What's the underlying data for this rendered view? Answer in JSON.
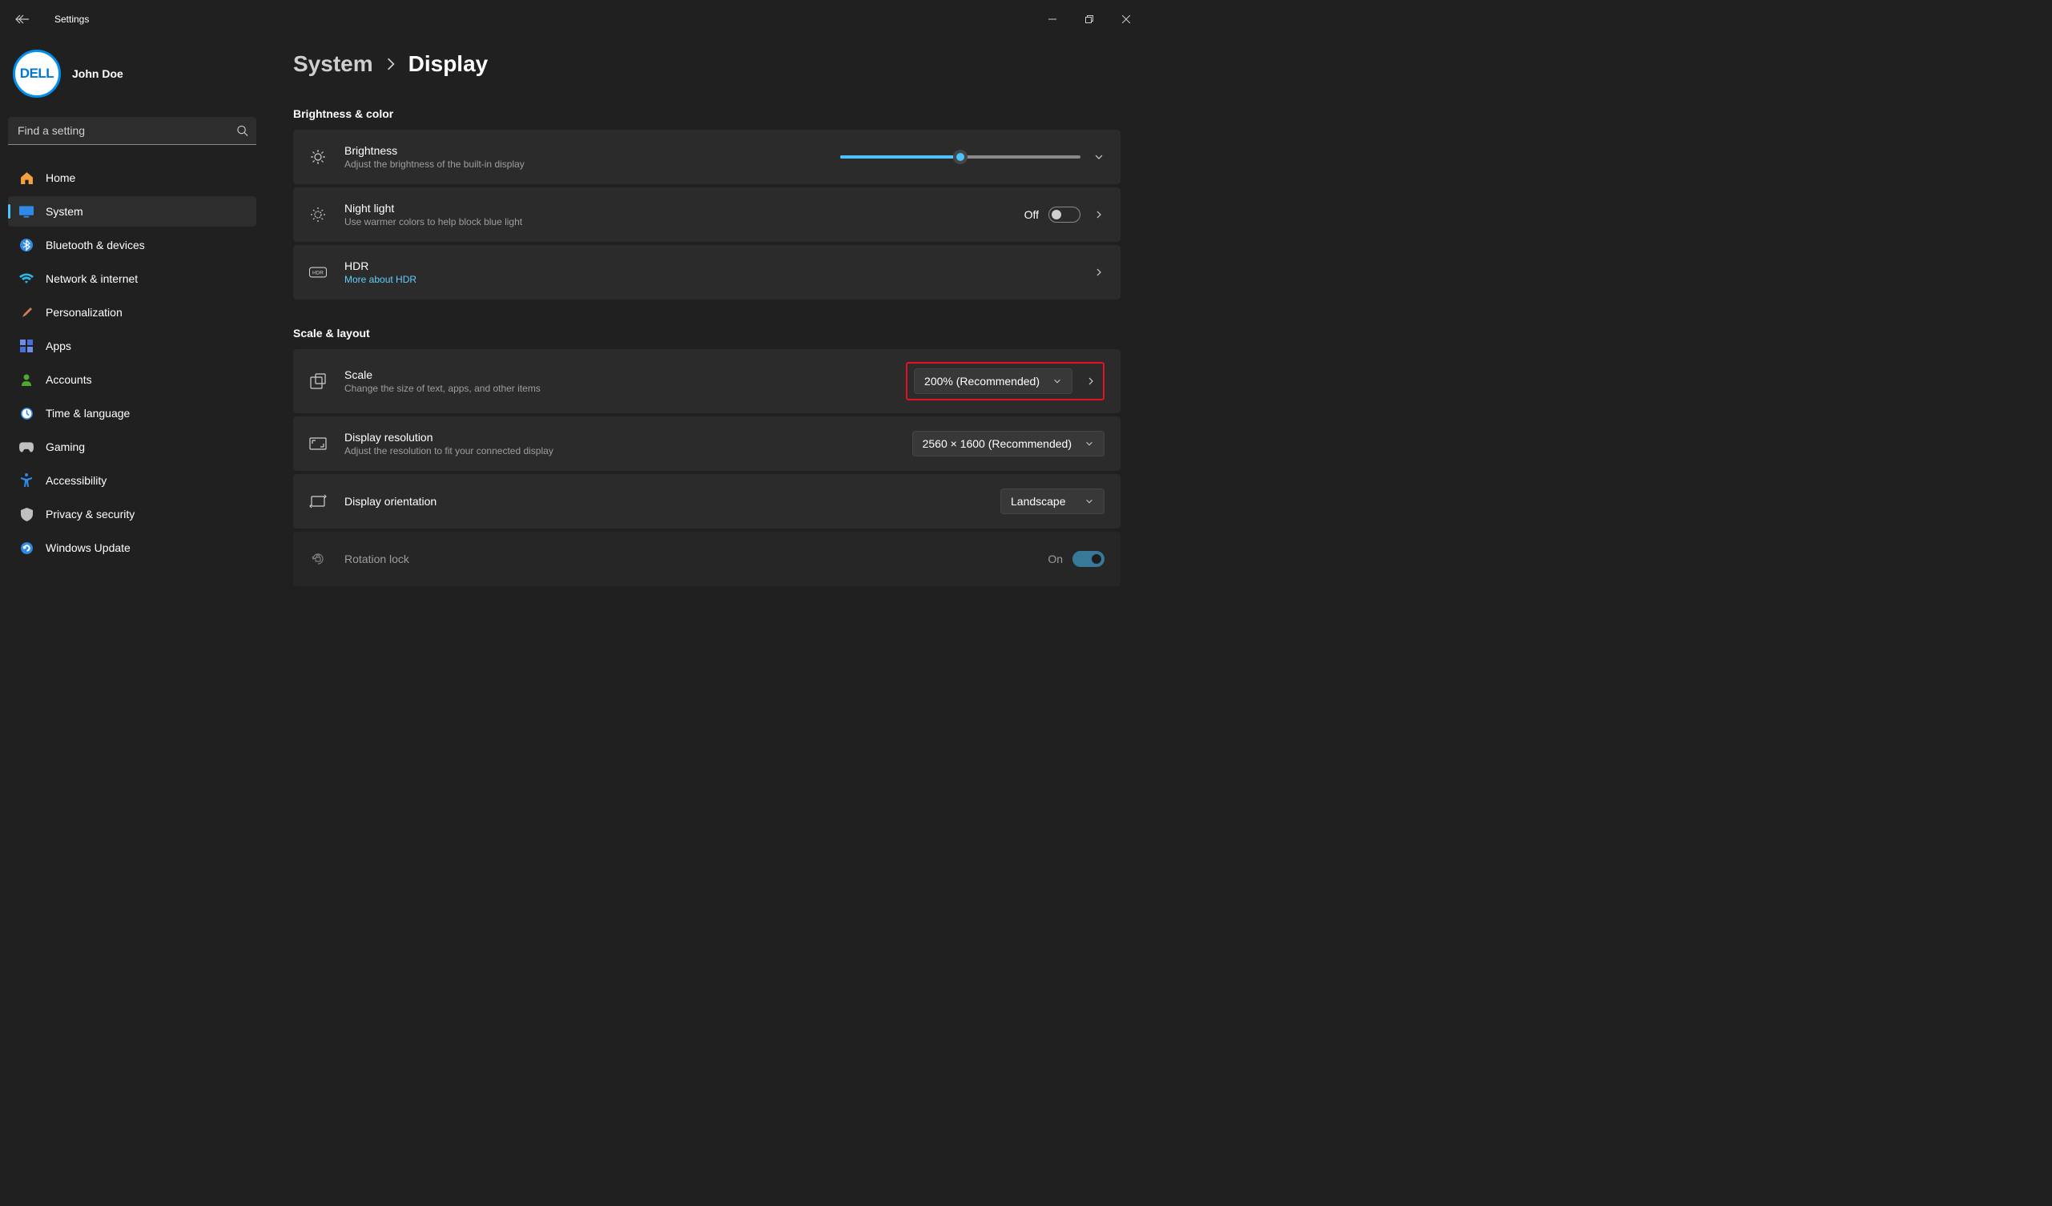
{
  "app": {
    "title": "Settings"
  },
  "user": {
    "name": "John Doe",
    "avatar_text": "DELL"
  },
  "search": {
    "placeholder": "Find a setting"
  },
  "nav": [
    {
      "label": "Home"
    },
    {
      "label": "System"
    },
    {
      "label": "Bluetooth & devices"
    },
    {
      "label": "Network & internet"
    },
    {
      "label": "Personalization"
    },
    {
      "label": "Apps"
    },
    {
      "label": "Accounts"
    },
    {
      "label": "Time & language"
    },
    {
      "label": "Gaming"
    },
    {
      "label": "Accessibility"
    },
    {
      "label": "Privacy & security"
    },
    {
      "label": "Windows Update"
    }
  ],
  "breadcrumb": {
    "parent": "System",
    "current": "Display"
  },
  "sections": {
    "brightness_color": {
      "title": "Brightness & color",
      "brightness": {
        "title": "Brightness",
        "sub": "Adjust the brightness of the built-in display",
        "percent": 50
      },
      "night_light": {
        "title": "Night light",
        "sub": "Use warmer colors to help block blue light",
        "state_label": "Off",
        "on": false
      },
      "hdr": {
        "title": "HDR",
        "link": "More about HDR"
      }
    },
    "scale_layout": {
      "title": "Scale & layout",
      "scale": {
        "title": "Scale",
        "sub": "Change the size of text, apps, and other items",
        "value": "200% (Recommended)"
      },
      "resolution": {
        "title": "Display resolution",
        "sub": "Adjust the resolution to fit your connected display",
        "value": "2560 × 1600 (Recommended)"
      },
      "orientation": {
        "title": "Display orientation",
        "value": "Landscape"
      },
      "rotation_lock": {
        "title": "Rotation lock",
        "state_label": "On",
        "on": true
      }
    }
  }
}
